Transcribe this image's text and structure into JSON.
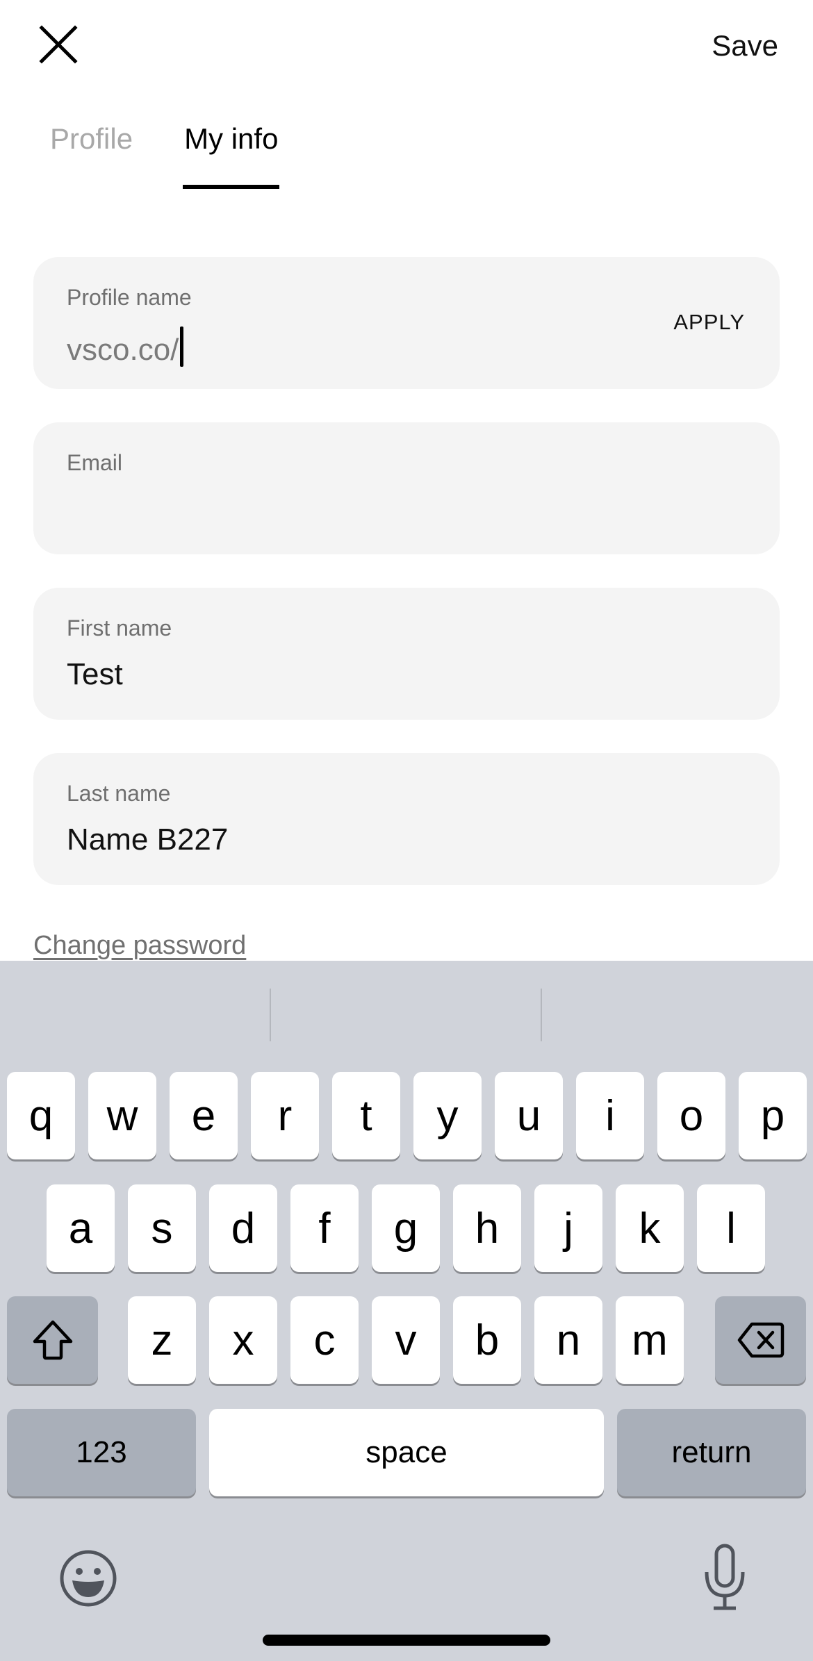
{
  "header": {
    "close_icon": "close-icon",
    "save_label": "Save"
  },
  "tabs": [
    {
      "label": "Profile",
      "active": false
    },
    {
      "label": "My info",
      "active": true
    }
  ],
  "form": {
    "profile_name": {
      "label": "Profile name",
      "prefix": "vsco.co/",
      "value": "",
      "action": "APPLY"
    },
    "email": {
      "label": "Email",
      "value": ""
    },
    "first_name": {
      "label": "First name",
      "value": "Test"
    },
    "last_name": {
      "label": "Last name",
      "value": "Name B227"
    },
    "change_password": "Change password"
  },
  "keyboard": {
    "row1": [
      "q",
      "w",
      "e",
      "r",
      "t",
      "y",
      "u",
      "i",
      "o",
      "p"
    ],
    "row2": [
      "a",
      "s",
      "d",
      "f",
      "g",
      "h",
      "j",
      "k",
      "l"
    ],
    "row3": [
      "z",
      "x",
      "c",
      "v",
      "b",
      "n",
      "m"
    ],
    "shift_icon": "shift-icon",
    "delete_icon": "backspace-icon",
    "numbers_label": "123",
    "space_label": "space",
    "return_label": "return",
    "emoji_icon": "emoji-icon",
    "mic_icon": "microphone-icon"
  }
}
